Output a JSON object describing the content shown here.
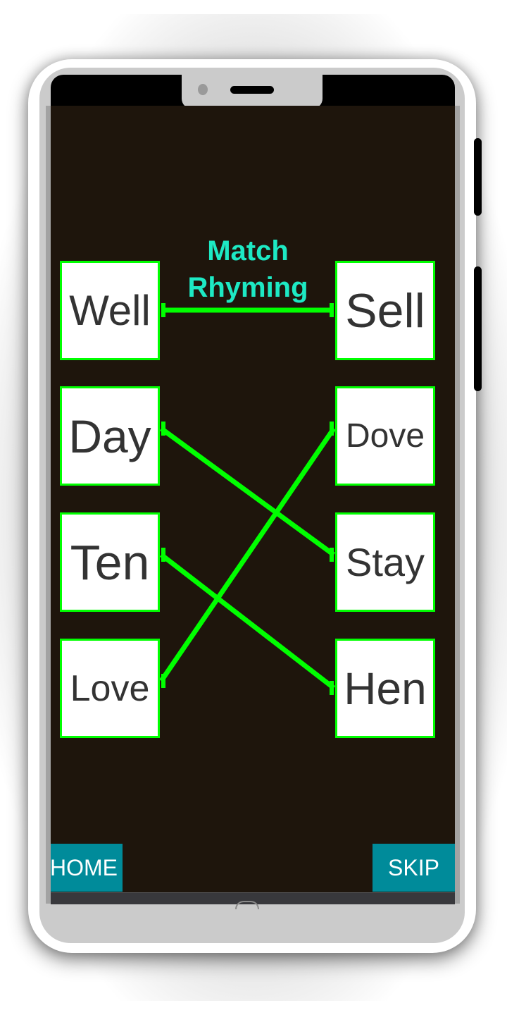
{
  "title": "Match Rhyming",
  "left_words": [
    "Well",
    "Day",
    "Ten",
    "Love"
  ],
  "right_words": [
    "Sell",
    "Dove",
    "Stay",
    "Hen"
  ],
  "matches": [
    {
      "left": "Well",
      "right": "Sell"
    },
    {
      "left": "Day",
      "right": "Stay"
    },
    {
      "left": "Ten",
      "right": "Hen"
    },
    {
      "left": "Love",
      "right": "Dove"
    }
  ],
  "buttons": {
    "home": "HOME",
    "skip": "SKIP"
  },
  "colors": {
    "background": "#1e150c",
    "title": "#1de9c4",
    "box_border": "#00ff00",
    "line": "#00ff00",
    "button": "#008b9a",
    "word_text": "#333333"
  }
}
